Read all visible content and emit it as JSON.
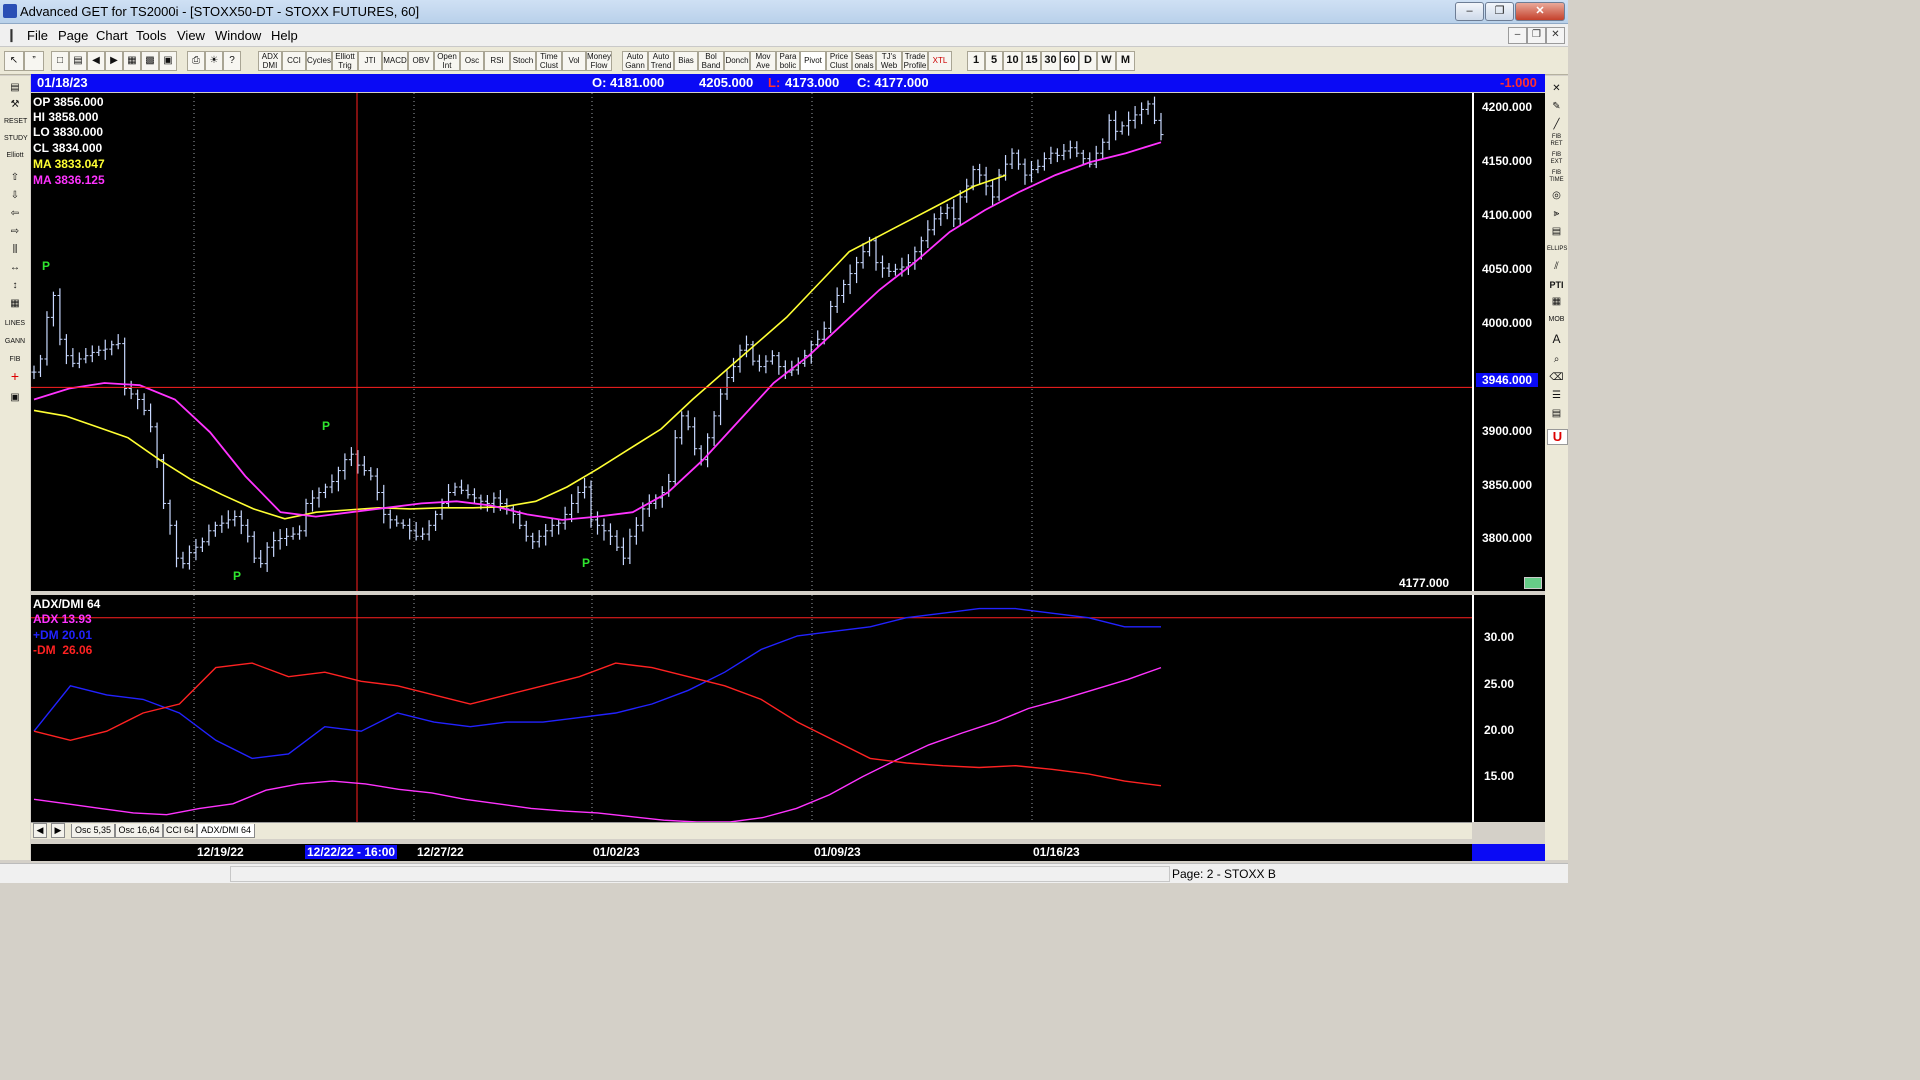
{
  "window": {
    "title": "Advanced GET for TS2000i - [STOXX50-DT - STOXX FUTURES, 60]",
    "controls": [
      "–",
      "❐",
      "✕"
    ]
  },
  "menu": [
    "File",
    "Page",
    "Chart",
    "Tools",
    "View",
    "Window",
    "Help"
  ],
  "toolbar": {
    "indicator_buttons": [
      "ADX DMI",
      "CCI",
      "Cycles",
      "Elliott Trig",
      "JTI",
      "MACD",
      "OBV",
      "Open Int",
      "Osc",
      "RSI",
      "Stoch",
      "Time Clust",
      "Vol",
      "Money Flow",
      "Auto Gann",
      "Auto Trend",
      "Bias",
      "Bol Band",
      "Donch",
      "Mov Ave",
      "Para bolic",
      "Pivot",
      "Price Clust",
      "Seas onals",
      "TJ's Web",
      "Trade Profile",
      "XTL"
    ],
    "timeframes": [
      "1",
      "5",
      "10",
      "15",
      "30",
      "60",
      "D",
      "W",
      "M"
    ],
    "selected_timeframe": "60"
  },
  "left_tools": [
    "RESET",
    "STUDY",
    "Elliott",
    "LINES",
    "GANN",
    "FIB"
  ],
  "right_tools": [
    "FIB RET",
    "FIB EXT",
    "FIB TIME",
    "ELLIPS",
    "PTI",
    "MOB",
    "A",
    "U"
  ],
  "info_bar": {
    "date": "01/18/23",
    "open": "O: 4181.000",
    "high": "4205.000",
    "low_label": "L:",
    "low_value": "4173.000",
    "close": "C: 4177.000",
    "change": "-1.000"
  },
  "price_panel": {
    "stats": [
      {
        "label": "OP",
        "value": "3856.000"
      },
      {
        "label": "HI",
        "value": "3858.000"
      },
      {
        "label": "LO",
        "value": "3830.000"
      },
      {
        "label": "CL",
        "value": "3834.000"
      },
      {
        "label": "MA",
        "value": "3833.047"
      },
      {
        "label": "MA",
        "value": "3836.125"
      }
    ],
    "y_labels": [
      "4200.000",
      "4150.000",
      "4100.000",
      "4050.000",
      "4000.000",
      "3900.000",
      "3850.000",
      "3800.000"
    ],
    "crosshair_price": "3946.000",
    "last_price": "4177.000",
    "pivot_marker": "P"
  },
  "indicator_panel": {
    "title": "ADX/DMI 64",
    "adx": "ADX 13.93",
    "plus_dm": "+DM 20.01",
    "minus_dm": "-DM  26.06",
    "y_labels": [
      "30.00",
      "25.00",
      "20.00",
      "15.00"
    ]
  },
  "tabs": [
    "Osc 5,35",
    "Osc 16,64",
    "CCI 64",
    "ADX/DMI 64"
  ],
  "selected_tab": "ADX/DMI 64",
  "dates": {
    "d1": "12/19/22",
    "cursor": "12/22/22 - 16:00",
    "d2": "12/27/22",
    "d3": "01/02/23",
    "d4": "01/09/23",
    "d5": "01/16/23"
  },
  "status": {
    "page": "Page: 2 - STOXX B"
  },
  "colors": {
    "background": "#000000",
    "bars": "#c8d8ff",
    "ma_fast": "#ffff33",
    "ma_slow": "#ff33ff",
    "adx": "#ff33ff",
    "plus_dm": "#2222ff",
    "minus_dm": "#ff2222",
    "crosshair": "#ff2020",
    "pivot": "#2ee52e",
    "info_bar": "#0a0af5"
  },
  "chart_data": [
    {
      "type": "line",
      "title": "",
      "ylim": [
        3760,
        4215
      ],
      "series": [
        {
          "name": "OHLC",
          "kind": "ohlc",
          "values": [
            3960,
            3972,
            4010,
            4030,
            3990,
            3975,
            3968,
            3972,
            3975,
            3978,
            3980,
            3981,
            3985,
            3986,
            3945,
            3940,
            3935,
            3925,
            3910,
            3880,
            3840,
            3820,
            3790,
            3785,
            3795,
            3800,
            3805,
            3815,
            3820,
            3822,
            3825,
            3828,
            3820,
            3810,
            3790,
            3785,
            3800,
            3806,
            3808,
            3810,
            3812,
            3815,
            3840,
            3845,
            3850,
            3855,
            3860,
            3870,
            3880,
            3885,
            3875,
            3870,
            3865,
            3850,
            3830,
            3825,
            3822,
            3820,
            3815,
            3810,
            3812,
            3820,
            3830,
            3840,
            3850,
            3855,
            3852,
            3848,
            3845,
            3842,
            3840,
            3845,
            3840,
            3835,
            3830,
            3820,
            3810,
            3805,
            3810,
            3815,
            3820,
            3822,
            3830,
            3840,
            3850,
            3855,
            3825,
            3820,
            3815,
            3810,
            3800,
            3790,
            3810,
            3820,
            3835,
            3840,
            3845,
            3850,
            3860,
            3900,
            3920,
            3910,
            3890,
            3880,
            3900,
            3920,
            3940,
            3955,
            3965,
            3980,
            3985,
            3970,
            3965,
            3970,
            3975,
            3965,
            3960,
            3962,
            3968,
            3975,
            3985,
            3990,
            4000,
            4020,
            4030,
            4040,
            4050,
            4060,
            4070,
            4080,
            4060,
            4055,
            4052,
            4054,
            4056,
            4060,
            4070,
            4080,
            4090,
            4100,
            4105,
            4110,
            4100,
            4120,
            4130,
            4145,
            4140,
            4130,
            4120,
            4140,
            4150,
            4160,
            4150,
            4140,
            4145,
            4148,
            4155,
            4160,
            4158,
            4162,
            4165,
            4160,
            4155,
            4150,
            4160,
            4170,
            4190,
            4180,
            4185,
            4190,
            4195,
            4200,
            4205,
            4190,
            4177
          ]
        },
        {
          "name": "MA",
          "kind": "ma_fast",
          "values": [
            3925,
            3920,
            3910,
            3900,
            3880,
            3862,
            3848,
            3835,
            3826,
            3832,
            3834,
            3836,
            3835,
            3836,
            3836,
            3837,
            3842,
            3855,
            3872,
            3890,
            3908,
            3935,
            3960,
            3985,
            4010,
            4040,
            4070,
            4085,
            4100,
            4115,
            4130,
            4140
          ]
        },
        {
          "name": "MA",
          "kind": "ma_slow",
          "values": [
            3935,
            3945,
            3950,
            3948,
            3935,
            3905,
            3865,
            3832,
            3828,
            3832,
            3836,
            3840,
            3842,
            3838,
            3830,
            3825,
            3828,
            3832,
            3850,
            3880,
            3915,
            3950,
            3975,
            4005,
            4035,
            4060,
            4088,
            4108,
            4125,
            4140,
            4152,
            4160,
            4170
          ]
        }
      ]
    },
    {
      "type": "line",
      "title": "ADX/DMI 64",
      "ylim": [
        10,
        35
      ],
      "series": [
        {
          "name": "ADX 13.93",
          "values": [
            12.5,
            12,
            11.5,
            11,
            10.8,
            11.5,
            12,
            13.5,
            14.2,
            14.5,
            14.2,
            13.6,
            13.2,
            12.5,
            12,
            11.5,
            11.2,
            11,
            10.6,
            10.2,
            10,
            10,
            10.5,
            11.5,
            13,
            15,
            16.8,
            18.5,
            19.8,
            21,
            22.5,
            23.5,
            24.6,
            25.7,
            27
          ]
        },
        {
          "name": "+DM 20.01",
          "values": [
            20,
            25,
            24,
            23.5,
            22,
            19,
            17,
            17.5,
            20.5,
            20,
            22,
            21,
            20.5,
            21,
            21,
            21.5,
            22,
            23,
            24.5,
            26.5,
            29,
            30.5,
            31,
            31.5,
            32.5,
            33,
            33.5,
            33.5,
            33,
            32.5,
            31.5,
            31.5
          ]
        },
        {
          "name": "-DM  26.06",
          "values": [
            20,
            19,
            20,
            22,
            23,
            27,
            27.5,
            26,
            26.5,
            25.5,
            25,
            24,
            23,
            24,
            25,
            26,
            27.5,
            27,
            26,
            25,
            23.5,
            21,
            19,
            17,
            16.5,
            16.2,
            16,
            16.2,
            15.8,
            15.3,
            14.5,
            14
          ]
        }
      ]
    }
  ]
}
